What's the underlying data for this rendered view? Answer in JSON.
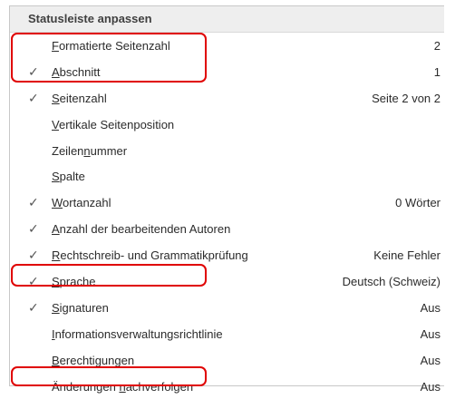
{
  "menu": {
    "title": "Statusleiste anpassen",
    "items": [
      {
        "checked": false,
        "pre": "",
        "u": "F",
        "post": "ormatierte Seitenzahl",
        "value": "2",
        "highlight": true
      },
      {
        "checked": true,
        "pre": "",
        "u": "A",
        "post": "bschnitt",
        "value": "1",
        "highlight": true
      },
      {
        "checked": true,
        "pre": "",
        "u": "S",
        "post": "eitenzahl",
        "value": "Seite 2 von 2",
        "highlight": false
      },
      {
        "checked": false,
        "pre": "",
        "u": "V",
        "post": "ertikale Seitenposition",
        "value": "",
        "highlight": false
      },
      {
        "checked": false,
        "pre": "Zeilen",
        "u": "n",
        "post": "ummer",
        "value": "",
        "highlight": false
      },
      {
        "checked": false,
        "pre": "",
        "u": "S",
        "post": "palte",
        "value": "",
        "highlight": false
      },
      {
        "checked": true,
        "pre": "",
        "u": "W",
        "post": "ortanzahl",
        "value": "0 Wörter",
        "highlight": false
      },
      {
        "checked": true,
        "pre": "",
        "u": "A",
        "post": "nzahl der bearbeitenden Autoren",
        "value": "",
        "highlight": false
      },
      {
        "checked": true,
        "pre": "",
        "u": "R",
        "post": "echtschreib- und Grammatikprüfung",
        "value": "Keine Fehler",
        "highlight": false
      },
      {
        "checked": true,
        "pre": "",
        "u": "S",
        "post": "prache",
        "value": "Deutsch (Schweiz)",
        "highlight": true
      },
      {
        "checked": true,
        "pre": "",
        "u": "S",
        "post": "ignaturen",
        "value": "Aus",
        "highlight": false
      },
      {
        "checked": false,
        "pre": "",
        "u": "I",
        "post": "nformationsverwaltungsrichtlinie",
        "value": "Aus",
        "highlight": false
      },
      {
        "checked": false,
        "pre": "",
        "u": "B",
        "post": "erechtigungen",
        "value": "Aus",
        "highlight": false
      },
      {
        "checked": false,
        "pre": "Änderungen ",
        "u": "n",
        "post": "achverfolgen",
        "value": "Aus",
        "highlight": true
      }
    ]
  },
  "colors": {
    "highlight_border": "#e00000",
    "header_bg": "#eeeeee"
  },
  "icons": {
    "check": "✓"
  }
}
